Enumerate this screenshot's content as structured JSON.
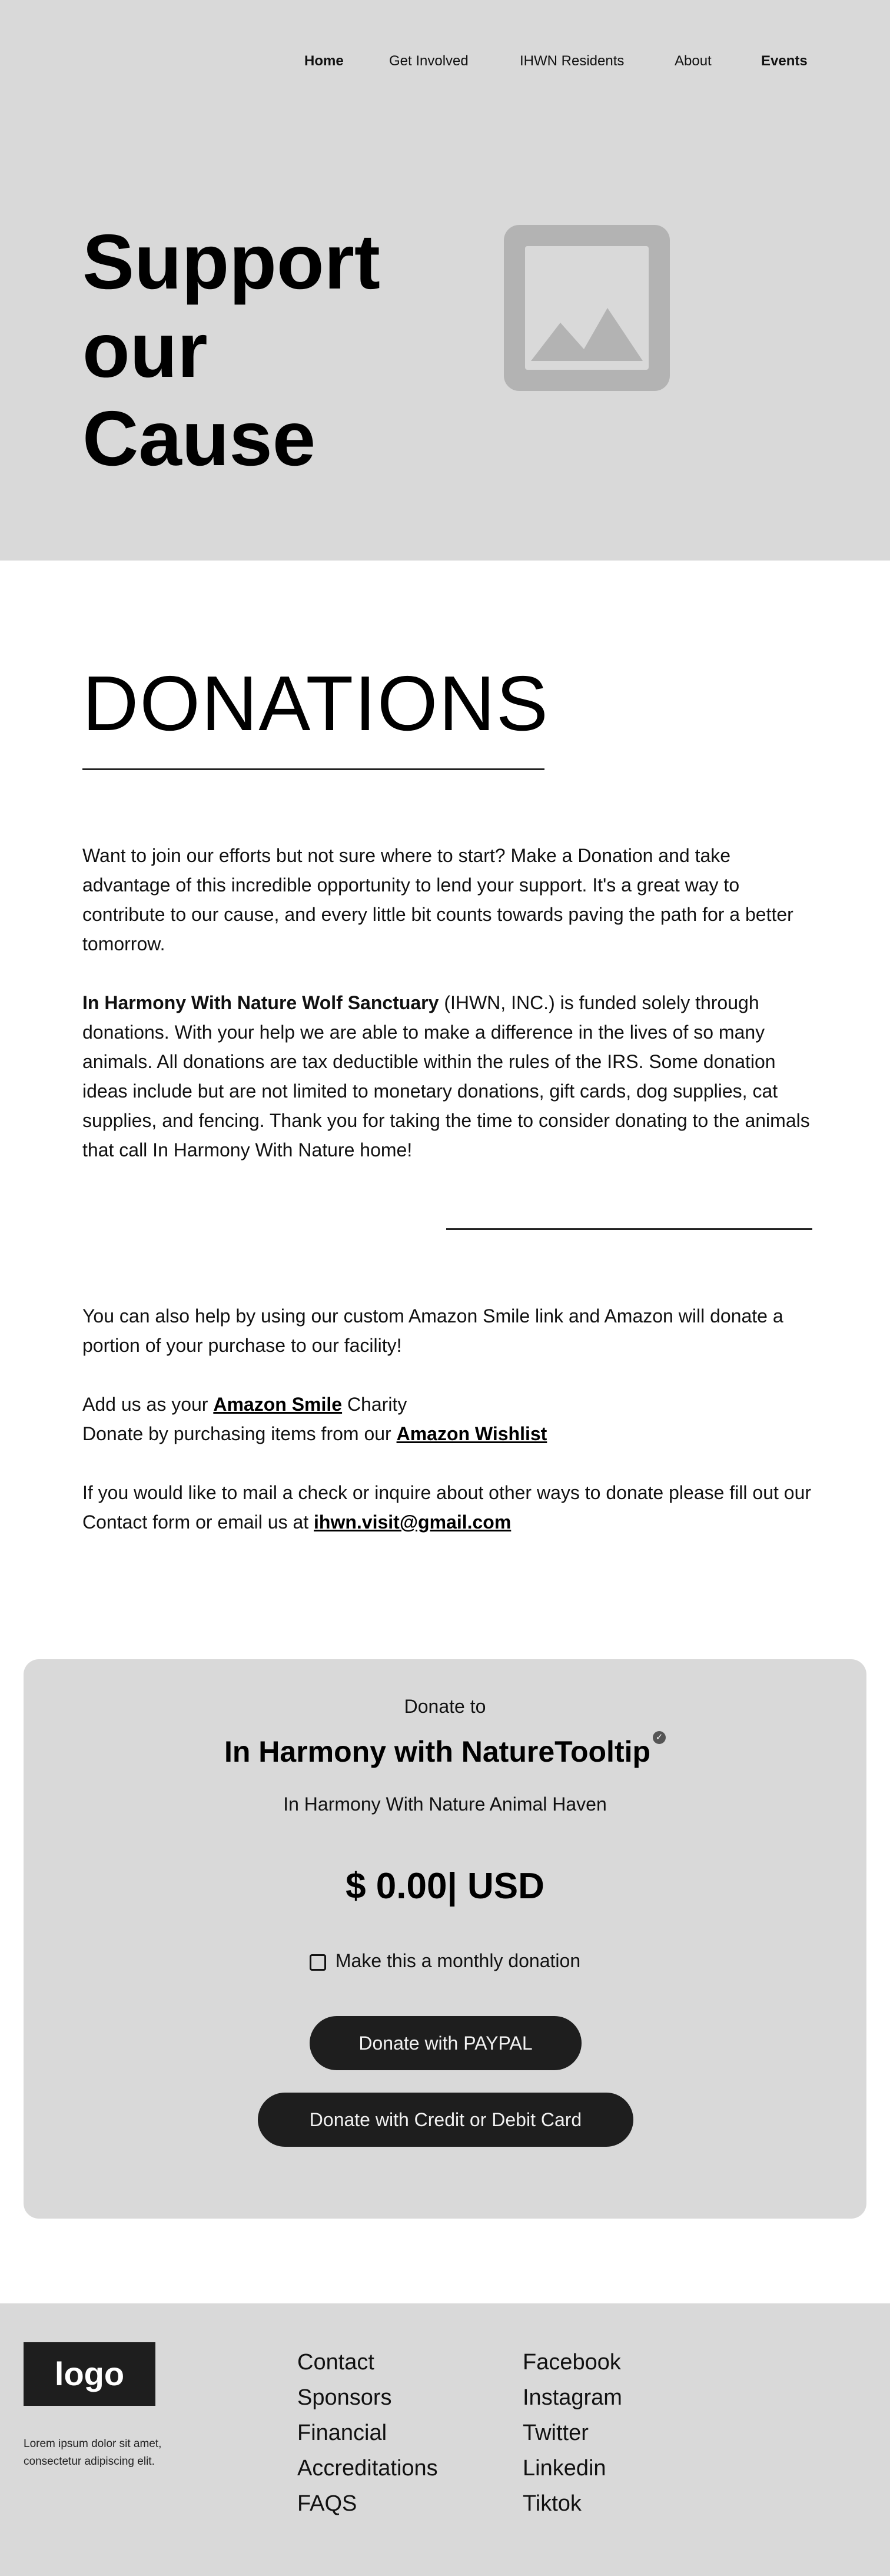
{
  "nav": {
    "items": [
      {
        "label": "Home",
        "active": true
      },
      {
        "label": "Get Involved",
        "active": false
      },
      {
        "label": "IHWN Residents",
        "active": false
      },
      {
        "label": "About",
        "active": false
      },
      {
        "label": "Events",
        "active": true
      }
    ]
  },
  "hero": {
    "title_line1": "Support",
    "title_line2": "our",
    "title_line3": "Cause",
    "image_icon": "image-placeholder-icon"
  },
  "donations": {
    "heading": "DONATIONS",
    "intro": "Want to join our efforts but not sure where to start? Make a Donation and take advantage of this incredible opportunity to lend your support. It's a great way to contribute to our cause, and every little bit counts towards paving the path for a better tomorrow.",
    "org_bold": "In Harmony With Nature Wolf Sanctuary",
    "org_text": " (IHWN, INC.) is funded solely through donations. With your help we are able to make a difference in the lives of so many animals. All donations are tax deductible within the rules of the IRS. Some donation ideas include but are not limited to monetary donations, gift cards, dog supplies, cat supplies, and fencing. Thank you for taking the time to consider donating to the animals that call In Harmony With Nature home!",
    "amazon_text": "You can also help by using our custom Amazon Smile link and Amazon will donate a portion of your purchase to our facility!",
    "smile_prefix": "Add us as your ",
    "smile_link": "Amazon Smile",
    "smile_suffix": " Charity",
    "wishlist_prefix": "Donate by purchasing items from our ",
    "wishlist_link": "Amazon Wishlist",
    "mail_text": "If you would like to mail a check or inquire about other ways to donate please fill out our Contact form or email us at ",
    "email_link": "ihwn.visit@gmail.com"
  },
  "donate_card": {
    "donate_to": "Donate to",
    "org_name": "In Harmony with NatureTooltip",
    "verified_icon": "verified-check-icon",
    "org_sub": "In Harmony With Nature Animal Haven",
    "amount": "$ 0.00| USD",
    "monthly_label": "Make this a monthly donation",
    "monthly_checked": false,
    "paypal_button": "Donate with PAYPAL",
    "card_button": "Donate with Credit or Debit Card"
  },
  "footer": {
    "logo": "logo",
    "text": "Lorem ipsum dolor sit amet, consectetur adipiscing elit.",
    "col1": [
      "Contact",
      "Sponsors",
      "Financial",
      "Accreditations",
      "FAQS"
    ],
    "col2": [
      "Facebook",
      "Instagram",
      "Twitter",
      "Linkedin",
      "Tiktok"
    ]
  },
  "colors": {
    "band_gray": "#d9d9d9",
    "button_dark": "#1e1e1e",
    "placeholder_gray": "#b3b3b3"
  }
}
